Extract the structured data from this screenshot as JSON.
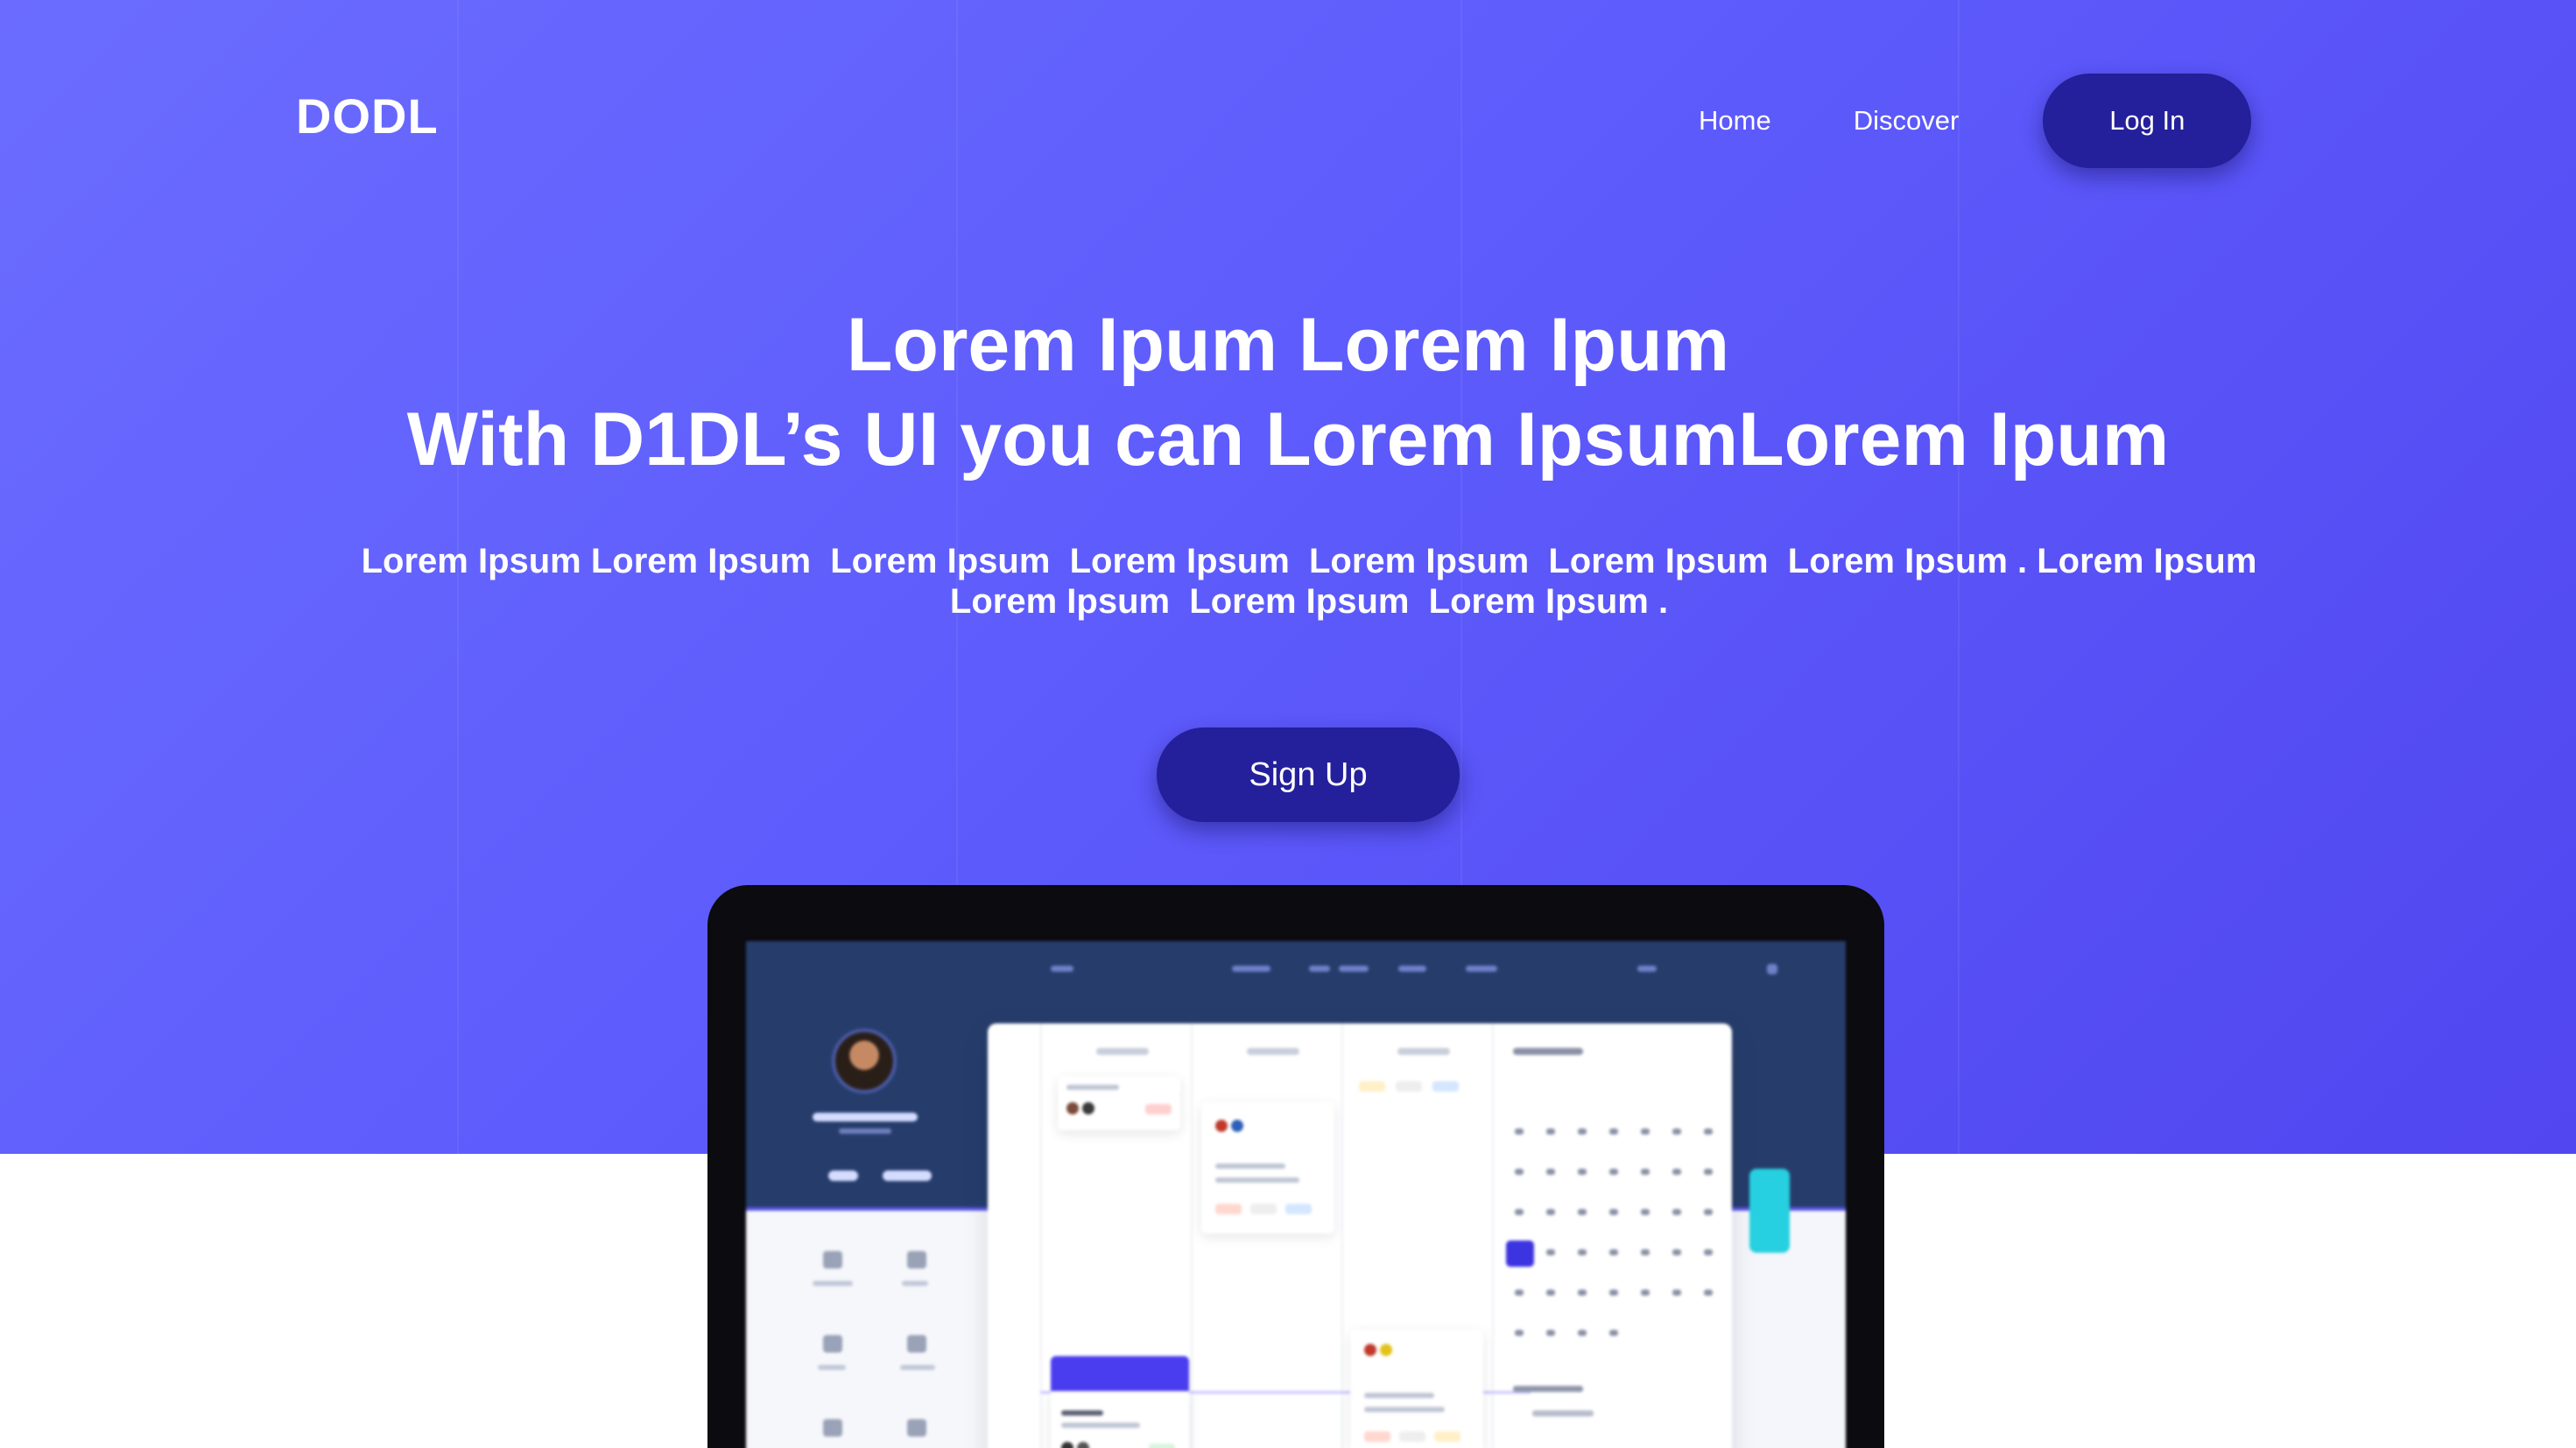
{
  "brand": {
    "logo": "DODL"
  },
  "nav": {
    "items": [
      "Home",
      "Discover"
    ],
    "login_label": "Log In"
  },
  "hero": {
    "headline_line1": "Lorem Ipum Lorem Ipum",
    "headline_line2": "With D1DL’s UI you can Lorem IpsumLorem Ipum",
    "subtext_line1": "Lorem Ipsum Lorem Ipsum  Lorem Ipsum  Lorem Ipsum  Lorem Ipsum  Lorem Ipsum  Lorem Ipsum . Lorem Ipsum",
    "subtext_line2": "Lorem Ipsum  Lorem Ipsum  Lorem Ipsum .",
    "signup_label": "Sign Up"
  },
  "colors": {
    "hero_gradient_start": "#6b6cff",
    "hero_gradient_end": "#5146f0",
    "button_dark": "#241f9a",
    "text": "#ffffff"
  }
}
